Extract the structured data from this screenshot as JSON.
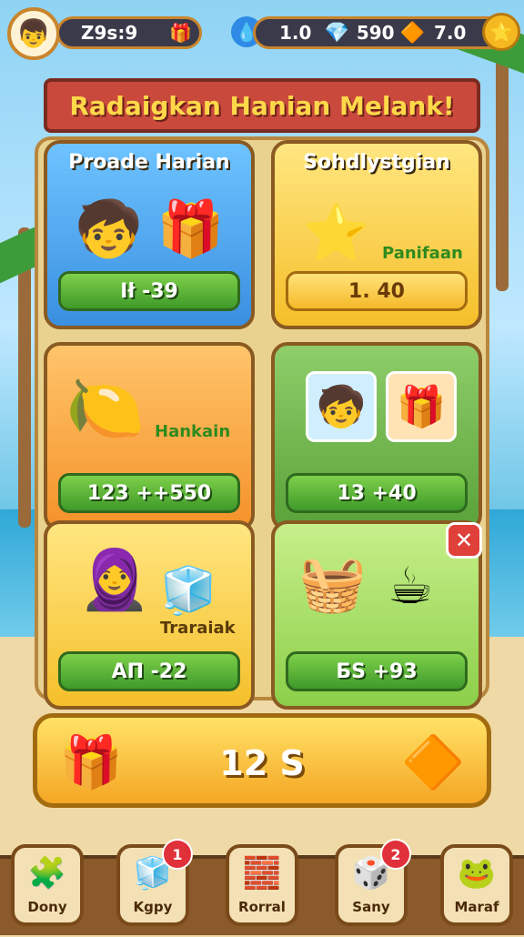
{
  "topbar": {
    "player_value": "Z9s:9",
    "blue_gem_value": "1.0",
    "crystal_value": "590",
    "star_value": "7.0"
  },
  "banner": {
    "title": "Radaigkan Hanian Melank!"
  },
  "cards": [
    {
      "title": "Proade Harian",
      "tag": "",
      "button": "Ił -39"
    },
    {
      "title": "Sohdlystgian",
      "tag": "Panifaan",
      "button": "1. 40"
    },
    {
      "title": "",
      "tag": "Hankain",
      "button": "123 ++550"
    },
    {
      "title": "",
      "tag": "",
      "button": "13 +40"
    },
    {
      "title": "",
      "tag": "Traraiak",
      "button": "AП -22"
    },
    {
      "title": "",
      "tag": "",
      "button": "БS +93"
    }
  ],
  "claim": {
    "label": "12 S"
  },
  "nav": [
    {
      "label": "Dony",
      "badge": ""
    },
    {
      "label": "Kgpy",
      "badge": "1"
    },
    {
      "label": "Rorral",
      "badge": ""
    },
    {
      "label": "Sany",
      "badge": "2"
    },
    {
      "label": "Maraf",
      "badge": ""
    }
  ],
  "close_label": "✕",
  "icons": [
    "avatar-icon",
    "blue-gem-icon",
    "crystal-icon",
    "orange-gem-icon",
    "star-icon",
    "gift-icon",
    "character-icon",
    "lemon-icon",
    "cube-icon",
    "basket-icon",
    "cup-icon"
  ]
}
